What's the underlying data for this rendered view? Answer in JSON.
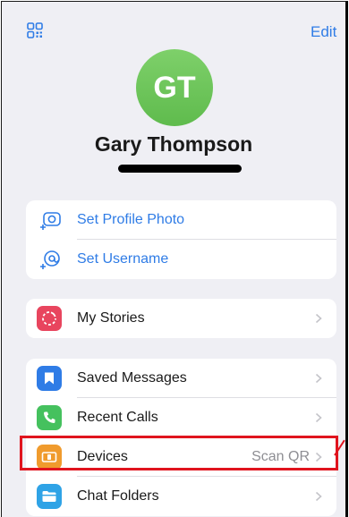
{
  "header": {
    "edit_label": "Edit"
  },
  "profile": {
    "initials": "GT",
    "name": "Gary Thompson"
  },
  "actions": [
    {
      "label": "Set Profile Photo",
      "icon": "camera-plus-icon"
    },
    {
      "label": "Set Username",
      "icon": "at-plus-icon"
    }
  ],
  "stories": {
    "label": "My Stories",
    "icon": "stories-icon",
    "color": "#e8455e"
  },
  "menu": [
    {
      "label": "Saved Messages",
      "value": "",
      "icon": "bookmark-icon",
      "color": "#2f7ce6"
    },
    {
      "label": "Recent Calls",
      "value": "",
      "icon": "phone-icon",
      "color": "#45c15e"
    },
    {
      "label": "Devices",
      "value": "Scan QR",
      "icon": "devices-icon",
      "color": "#f09b2d"
    },
    {
      "label": "Chat Folders",
      "value": "",
      "icon": "folder-icon",
      "color": "#2fa3e6"
    }
  ],
  "colors": {
    "accent": "#2f7ce6",
    "avatar": "#6bc458",
    "annotation": "#e0141e"
  }
}
